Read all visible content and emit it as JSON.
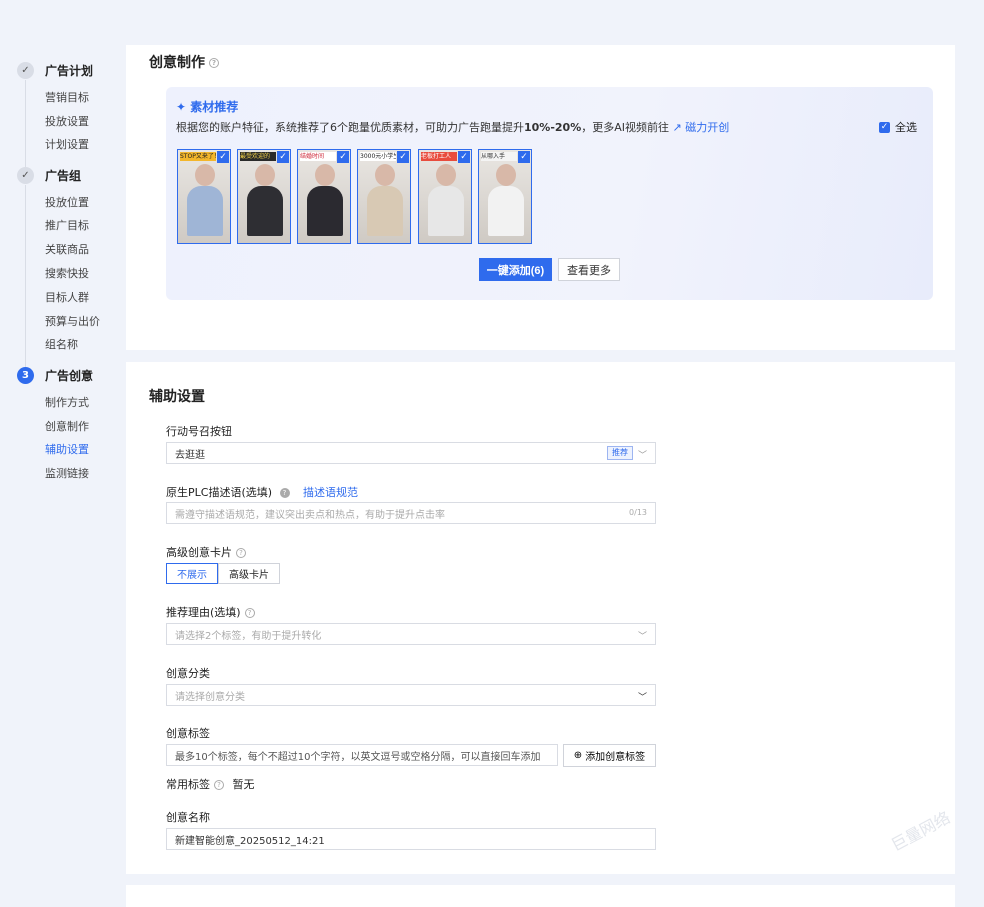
{
  "sidebar": {
    "groups": [
      {
        "index": "✓",
        "label": "广告计划",
        "items": [
          "营销目标",
          "投放设置",
          "计划设置"
        ]
      },
      {
        "index": "✓",
        "label": "广告组",
        "items": [
          "投放位置",
          "推广目标",
          "关联商品",
          "搜索快投",
          "目标人群",
          "预算与出价",
          "组名称"
        ]
      },
      {
        "index": "3",
        "label": "广告创意",
        "items": [
          "制作方式",
          "创意制作",
          "辅助设置",
          "监测链接"
        ]
      }
    ],
    "active_item": "辅助设置"
  },
  "creative": {
    "title": "创意制作",
    "rec_title": "素材推荐",
    "rec_desc_prefix": "根据您的账户特征，系统推荐了6个跑量优质素材，可助力广告跑量提升",
    "rec_desc_bold": "10%-20%",
    "rec_desc_suffix": "，更多AI视频前往",
    "rec_link": "磁力开创",
    "select_all": "全选",
    "thumbs": [
      {
        "caption": "STOP又来了！",
        "cap_bg": "#f3b62b",
        "cap_color": "#222",
        "body": "#9fb5d6"
      },
      {
        "caption": "最受欢迎的",
        "cap_bg": "#2a2a2a",
        "cap_color": "#f3d24a",
        "body": "#2e2e33"
      },
      {
        "caption": "结婚时间",
        "cap_bg": "#ffffff",
        "cap_color": "#c23",
        "body": "#2b2a30"
      },
      {
        "caption": "3000元小学生",
        "cap_bg": "#fff",
        "cap_color": "#222",
        "body": "#d8c9b4"
      },
      {
        "caption": "老板打工人",
        "cap_bg": "#e84c3d",
        "cap_color": "#fff",
        "body": "#e7e7e7"
      },
      {
        "caption": "从哪入手",
        "cap_bg": "#f4f4f4",
        "cap_color": "#333",
        "body": "#f2f2f2"
      }
    ],
    "add_button": "一键添加(6)",
    "more_button": "查看更多"
  },
  "aux": {
    "title": "辅助设置",
    "action_label": "行动号召按钮",
    "action_value": "去逛逛",
    "action_tag": "推荐",
    "plc_label": "原生PLC描述语(选填)",
    "plc_link": "描述语规范",
    "plc_placeholder": "需遵守描述语规范，建议突出卖点和热点，有助于提升点击率",
    "plc_counter": "0/13",
    "card_label": "高级创意卡片",
    "card_options": [
      "不展示",
      "高级卡片"
    ],
    "reason_label": "推荐理由(选填)",
    "reason_placeholder": "请选择2个标签，有助于提升转化",
    "category_label": "创意分类",
    "category_placeholder": "请选择创意分类",
    "tags_label": "创意标签",
    "tags_placeholder": "最多10个标签，每个不超过10个字符，以英文逗号或空格分隔，可以直接回车添加",
    "add_tag_button": "添加创意标签",
    "common_tags_label": "常用标签",
    "common_tags_value": "暂无",
    "name_label": "创意名称",
    "name_value": "新建智能创意_20250512_14:21"
  },
  "watermark": "巨量网络"
}
